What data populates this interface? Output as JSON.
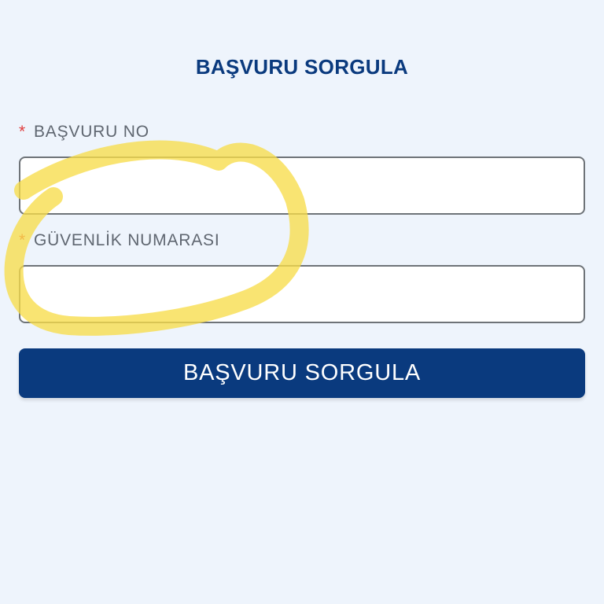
{
  "page": {
    "title": "BAŞVURU SORGULA"
  },
  "form": {
    "required_marker": "*",
    "fields": [
      {
        "label": "BAŞVURU NO",
        "value": "",
        "placeholder": ""
      },
      {
        "label": "GÜVENLİK NUMARASI",
        "value": "",
        "placeholder": ""
      }
    ],
    "submit_label": "BAŞVURU SORGULA"
  },
  "colors": {
    "background": "#eef4fc",
    "brand": "#0a3a7e",
    "required": "#e03a3a",
    "label_text": "#5f6670",
    "highlight": "#f7dc4a"
  }
}
